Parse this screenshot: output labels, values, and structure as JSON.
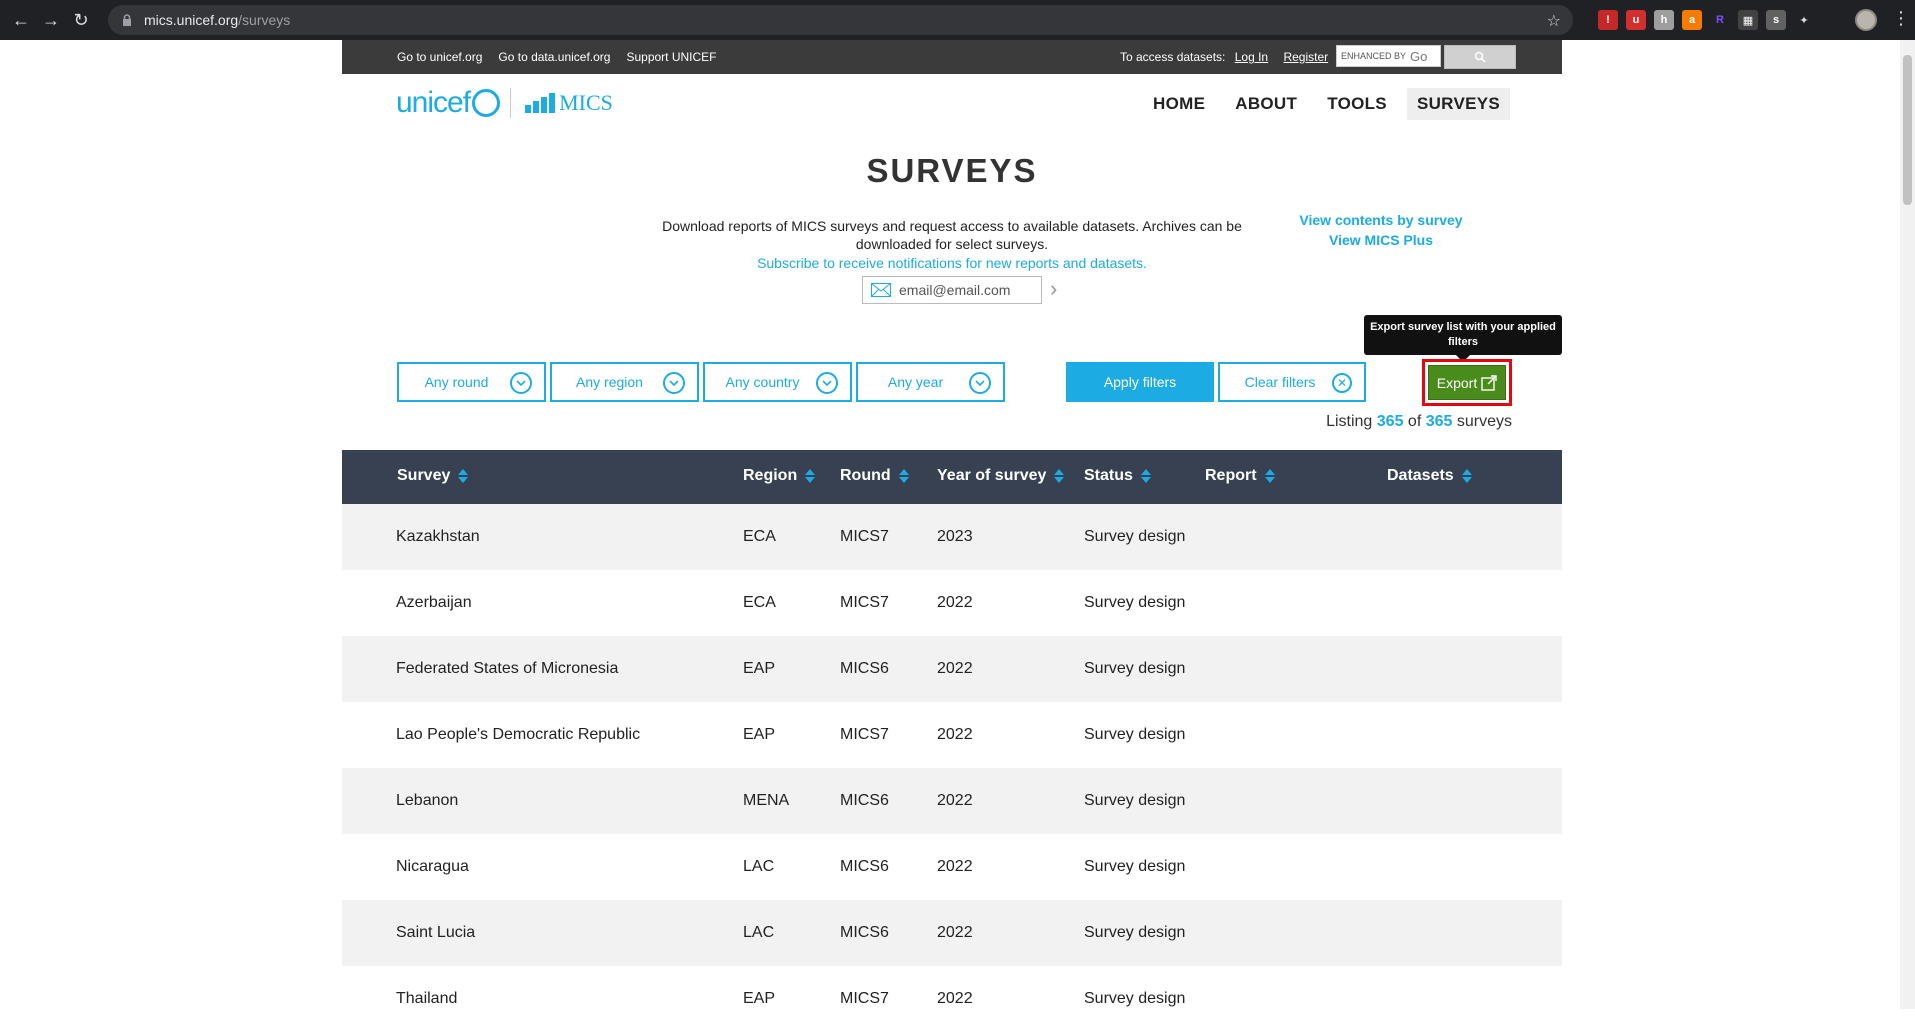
{
  "browser": {
    "url_host": "mics.unicef.org",
    "url_path": "/surveys"
  },
  "topbar": {
    "links": [
      "Go to unicef.org",
      "Go to data.unicef.org",
      "Support UNICEF"
    ],
    "access_text": "To access datasets:",
    "login": "Log In",
    "register": "Register",
    "search_placeholder": "ENHANCED BY",
    "search_brand": "Go"
  },
  "logo": {
    "unicef": "unicef",
    "mics": "MICS"
  },
  "nav": {
    "items": [
      "HOME",
      "ABOUT",
      "TOOLS",
      "SURVEYS"
    ],
    "active": "SURVEYS"
  },
  "page": {
    "title": "SURVEYS",
    "side_links": [
      "View contents by survey",
      "View MICS Plus"
    ],
    "description": "Download reports of MICS surveys and request access to available datasets. Archives can be downloaded for select surveys.",
    "subscribe": "Subscribe to receive notifications for new reports and datasets.",
    "email_placeholder": "email@email.com"
  },
  "filters": {
    "round": "Any round",
    "region": "Any region",
    "country": "Any country",
    "year": "Any year",
    "apply": "Apply filters",
    "clear": "Clear filters",
    "export": "Export",
    "tooltip": "Export survey list with your applied filters"
  },
  "listing": {
    "prefix": "Listing",
    "shown": "365",
    "of": "of",
    "total": "365",
    "suffix": "surveys"
  },
  "table": {
    "headers": {
      "survey": "Survey",
      "region": "Region",
      "round": "Round",
      "year": "Year of survey",
      "status": "Status",
      "report": "Report",
      "datasets": "Datasets"
    },
    "rows": [
      {
        "survey": "Kazakhstan",
        "region": "ECA",
        "round": "MICS7",
        "year": "2023",
        "status": "Survey design"
      },
      {
        "survey": "Azerbaijan",
        "region": "ECA",
        "round": "MICS7",
        "year": "2022",
        "status": "Survey design"
      },
      {
        "survey": "Federated States of Micronesia",
        "region": "EAP",
        "round": "MICS6",
        "year": "2022",
        "status": "Survey design"
      },
      {
        "survey": "Lao People's Democratic Republic",
        "region": "EAP",
        "round": "MICS7",
        "year": "2022",
        "status": "Survey design"
      },
      {
        "survey": "Lebanon",
        "region": "MENA",
        "round": "MICS6",
        "year": "2022",
        "status": "Survey design"
      },
      {
        "survey": "Nicaragua",
        "region": "LAC",
        "round": "MICS6",
        "year": "2022",
        "status": "Survey design"
      },
      {
        "survey": "Saint Lucia",
        "region": "LAC",
        "round": "MICS6",
        "year": "2022",
        "status": "Survey design"
      },
      {
        "survey": "Thailand",
        "region": "EAP",
        "round": "MICS7",
        "year": "2022",
        "status": "Survey design"
      }
    ]
  },
  "colors": {
    "accent": "#1cabe2",
    "table_header": "#374152",
    "export_green": "#4a8c1c",
    "highlight_red": "#e30613"
  }
}
